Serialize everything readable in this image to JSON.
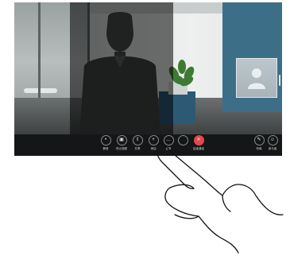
{
  "controls": [
    {
      "icon": "mic-icon",
      "glyph": "•",
      "label": "静音"
    },
    {
      "icon": "video-icon",
      "glyph": "▣",
      "label": "停止视频"
    },
    {
      "icon": "share-icon",
      "glyph": "⇧",
      "label": "共享"
    },
    {
      "icon": "add-participant-icon",
      "glyph": "+",
      "label": "添加"
    },
    {
      "icon": "more-icon",
      "glyph": "…",
      "label": "更多"
    },
    {
      "icon": "empty-icon",
      "glyph": "",
      "label": ""
    },
    {
      "icon": "end-call-icon",
      "glyph": "✕",
      "label": "结束通话"
    }
  ],
  "right_controls": [
    {
      "icon": "layout-icon",
      "glyph": "✎",
      "label": "布局"
    },
    {
      "icon": "participants-icon",
      "glyph": "☺",
      "label": "参与者"
    }
  ],
  "colors": {
    "end_call": "#e4474e",
    "control_bar": "#151617",
    "panel": "#3d6e87"
  }
}
